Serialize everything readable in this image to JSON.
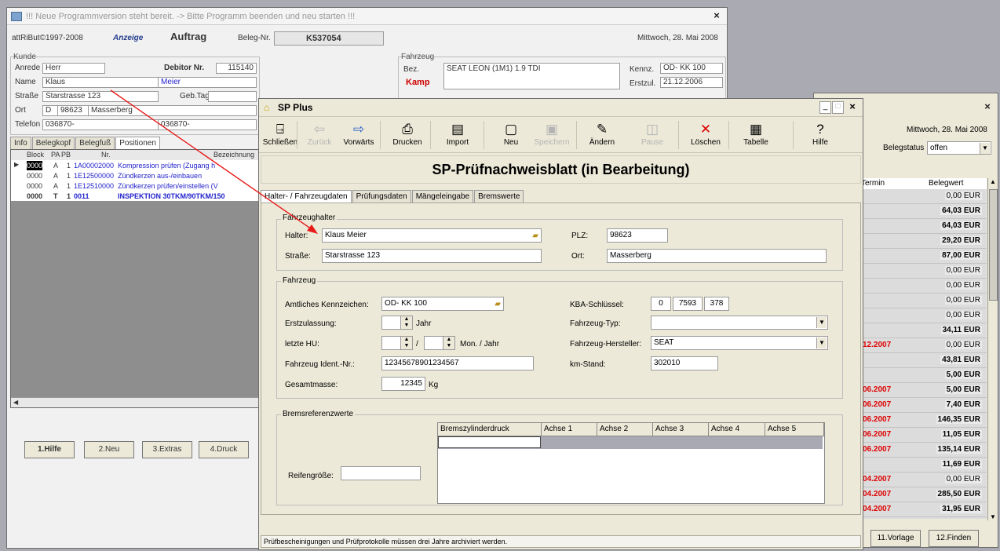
{
  "back_window": {
    "title": "!!! Neue Programmversion steht bereit. -> Bitte Programm beenden und neu starten !!!",
    "copyright": "attRiBut©1997-2008",
    "mode": "Anzeige",
    "doc_type": "Auftrag",
    "beleg_label": "Beleg-Nr.",
    "beleg_nr": "K537054",
    "date": "Mittwoch, 28. Mai 2008",
    "kunde": {
      "title": "Kunde",
      "anrede_label": "Anrede",
      "anrede": "Herr",
      "debitor_label": "Debitor Nr.",
      "debitor": "115140",
      "name_label": "Name",
      "vorname": "Klaus",
      "nachname": "Meier",
      "strasse_label": "Straße",
      "strasse": "Starstrasse 123",
      "gebtag_label": "Geb.Tag",
      "ort_label": "Ort",
      "land": "D",
      "plz": "98623",
      "ort": "Masserberg",
      "telefon_label": "Telefon",
      "telefon": "036870-",
      "telefon2": "036870-"
    },
    "fahrzeug": {
      "title": "Fahrzeug",
      "bez_label": "Bez.",
      "bez": "SEAT LEON (1M1) 1.9 TDI",
      "kamp": "Kamp",
      "kennz_label": "Kennz.",
      "kennz": "OD- KK 100",
      "erstzul_label": "Erstzul.",
      "erstzul": "21.12.2006"
    },
    "tabs": [
      "Info",
      "Belegkopf",
      "Belegfuß",
      "Positionen"
    ],
    "grid_headers": [
      "Block",
      "PA",
      "PB",
      "Nr.",
      "Bezeichnung"
    ],
    "grid_rows": [
      {
        "block": "0000",
        "pa": "A",
        "pb": "1",
        "nr": "1A00002000",
        "bez": "Kompression prüfen (Zugang h"
      },
      {
        "block": "0000",
        "pa": "A",
        "pb": "1",
        "nr": "1E12500000",
        "bez": "Zündkerzen aus-/einbauen"
      },
      {
        "block": "0000",
        "pa": "A",
        "pb": "1",
        "nr": "1E12510000",
        "bez": "Zündkerzen prüfen/einstellen (V"
      },
      {
        "block": "0000",
        "pa": "T",
        "pb": "1",
        "nr": "0011",
        "bez": "INSPEKTION 30TKM/90TKM/150"
      }
    ],
    "buttons": [
      "1.Hilfe",
      "2.Neu",
      "3.Extras",
      "4.Druck"
    ]
  },
  "right_window": {
    "date": "Mittwoch, 28. Mai 2008",
    "belegstatus_label": "Belegstatus",
    "belegstatus": "offen",
    "col_termin": "Termin",
    "col_belegwert": "Belegwert",
    "rows": [
      {
        "termin": "",
        "wert": "0,00 EUR"
      },
      {
        "termin": "",
        "wert": "64,03 EUR"
      },
      {
        "termin": "",
        "wert": "64,03 EUR"
      },
      {
        "termin": "",
        "wert": "29,20 EUR"
      },
      {
        "termin": "",
        "wert": "87,00 EUR"
      },
      {
        "termin": "",
        "wert": "0,00 EUR"
      },
      {
        "termin": "",
        "wert": "0,00 EUR"
      },
      {
        "termin": "",
        "wert": "0,00 EUR"
      },
      {
        "termin": "",
        "wert": "0,00 EUR"
      },
      {
        "termin": "",
        "wert": "34,11 EUR"
      },
      {
        "termin": "12.2007",
        "wert": "0,00 EUR"
      },
      {
        "termin": "",
        "wert": "43,81 EUR"
      },
      {
        "termin": "",
        "wert": "5,00 EUR"
      },
      {
        "termin": "06.2007",
        "wert": "5,00 EUR"
      },
      {
        "termin": "06.2007",
        "wert": "7,40 EUR"
      },
      {
        "termin": "06.2007",
        "wert": "146,35 EUR"
      },
      {
        "termin": "06.2007",
        "wert": "11,05 EUR"
      },
      {
        "termin": "06.2007",
        "wert": "135,14 EUR"
      },
      {
        "termin": "",
        "wert": "11,69 EUR"
      },
      {
        "termin": "04.2007",
        "wert": "0,00 EUR"
      },
      {
        "termin": "04.2007",
        "wert": "285,50 EUR"
      },
      {
        "termin": "04.2007",
        "wert": "31,95 EUR"
      }
    ],
    "buttons": [
      "11.Vorlage",
      "12.Finden"
    ]
  },
  "sp_window": {
    "title": "SP Plus",
    "toolbar": [
      {
        "label": "Schließen",
        "icon": "exit-icon",
        "glyph": "⍈",
        "enabled": true
      },
      {
        "label": "Zurück",
        "icon": "arrow-left-icon",
        "glyph": "⇦",
        "enabled": false
      },
      {
        "label": "Vorwärts",
        "icon": "arrow-right-icon",
        "glyph": "⇨",
        "enabled": true
      },
      {
        "label": "Drucken",
        "icon": "printer-icon",
        "glyph": "⎙",
        "enabled": true
      },
      {
        "label": "Import",
        "icon": "import-icon",
        "glyph": "▤",
        "enabled": true
      },
      {
        "label": "Neu",
        "icon": "new-document-icon",
        "glyph": "▢",
        "enabled": true
      },
      {
        "label": "Speichern",
        "icon": "save-icon",
        "glyph": "▣",
        "enabled": false
      },
      {
        "label": "Ändern",
        "icon": "edit-icon",
        "glyph": "✎",
        "enabled": true
      },
      {
        "label": "Pause",
        "icon": "pause-icon",
        "glyph": "◫",
        "enabled": false
      },
      {
        "label": "Löschen",
        "icon": "delete-icon",
        "glyph": "✕",
        "enabled": true
      },
      {
        "label": "Tabelle",
        "icon": "table-icon",
        "glyph": "▦",
        "enabled": true
      },
      {
        "label": "Hilfe",
        "icon": "help-icon",
        "glyph": "?",
        "enabled": true
      }
    ],
    "heading": "SP-Prüfnachweisblatt (in Bearbeitung)",
    "tabs": [
      "Halter- / Fahrzeugdaten",
      "Prüfungsdaten",
      "Mängeleingabe",
      "Bremswerte"
    ],
    "halter_group": "Fahrzeughalter",
    "halter_label": "Halter:",
    "halter": "Klaus Meier",
    "plz_label": "PLZ:",
    "plz": "98623",
    "strasse_label": "Straße:",
    "strasse": "Starstrasse 123",
    "ort_label": "Ort:",
    "ort": "Masserberg",
    "fahrzeug_group": "Fahrzeug",
    "kennzeichen_label": "Amtliches Kennzeichen:",
    "kennzeichen": "OD- KK 100",
    "kba_label": "KBA-Schlüssel:",
    "kba1": "0",
    "kba2": "7593",
    "kba3": "378",
    "erstzulassung_label": "Erstzulassung:",
    "jahr_label": "Jahr",
    "typ_label": "Fahrzeug-Typ:",
    "typ": "",
    "hu_label": "letzte HU:",
    "hu_sep": "/",
    "hu_unit": "Mon. / Jahr",
    "hersteller_label": "Fahrzeug-Hersteller:",
    "hersteller": "SEAT",
    "ident_label": "Fahrzeug Ident.-Nr.:",
    "ident": "12345678901234567",
    "km_label": "km-Stand:",
    "km": "302010",
    "masse_label": "Gesamtmasse:",
    "masse": "12345",
    "masse_unit": "Kg",
    "brems_group": "Bremsreferenzwerte",
    "brems_headers": [
      "Bremszylinderdruck",
      "Achse 1",
      "Achse 2",
      "Achse 3",
      "Achse 4",
      "Achse 5"
    ],
    "reifen_label": "Reifengröße:",
    "status": "Prüfbescheinigungen und Prüfprotokolle müssen drei Jahre archiviert werden."
  }
}
